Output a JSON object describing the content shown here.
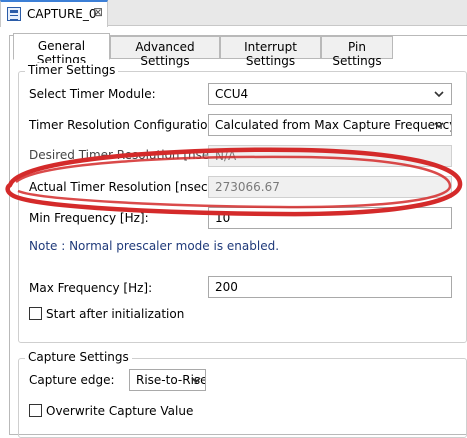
{
  "editor_tab": {
    "title": "CAPTURE_0",
    "close_glyph": "⊠",
    "icon": "config-file-icon"
  },
  "tabs": [
    {
      "label": "General Settings",
      "active": true
    },
    {
      "label": "Advanced Settings",
      "active": false
    },
    {
      "label": "Interrupt Settings",
      "active": false
    },
    {
      "label": "Pin Settings",
      "active": false
    }
  ],
  "timer_settings": {
    "title": "Timer Settings",
    "select_timer_module": {
      "label": "Select Timer Module:",
      "value": "CCU4"
    },
    "timer_resolution_configuration": {
      "label": "Timer Resolution Configuration:",
      "value": "Calculated from Max Capture Frequency"
    },
    "desired_timer_resolution": {
      "label": "Desired Timer Resolution [nsec]:",
      "value": "N/A"
    },
    "actual_timer_resolution": {
      "label": "Actual Timer Resolution [nsec]:",
      "value": "273066.67"
    },
    "min_frequency": {
      "label": "Min Frequency [Hz]:",
      "value": "10"
    },
    "note": "Note : Normal prescaler mode is enabled.",
    "max_frequency": {
      "label": "Max Frequency [Hz]:",
      "value": "200"
    },
    "start_after_init": {
      "label": "Start after initialization",
      "checked": false
    }
  },
  "capture_settings": {
    "title": "Capture Settings",
    "capture_edge": {
      "label": "Capture edge:",
      "value": "Rise-to-Rise"
    },
    "overwrite_capture_value": {
      "label": "Overwrite Capture Value",
      "checked": false
    }
  },
  "annotation": {
    "color": "#d42a2a"
  }
}
